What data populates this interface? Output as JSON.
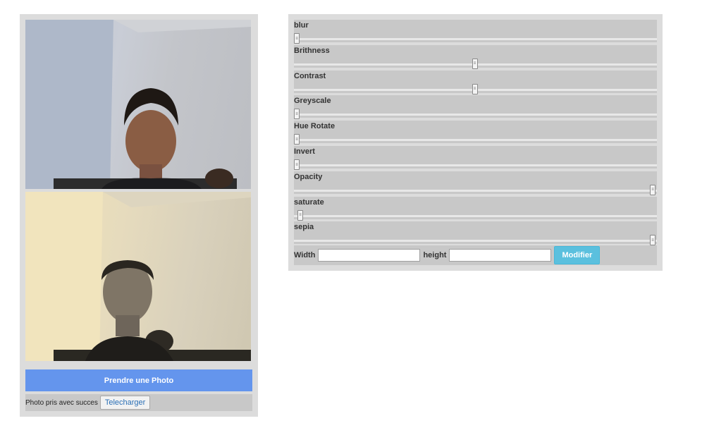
{
  "camera": {
    "take_photo_label": "Prendre une Photo",
    "status_text": "Photo pris avec succes",
    "download_label": "Telecharger"
  },
  "filters": [
    {
      "label": "blur",
      "value": 0.0
    },
    {
      "label": "Brithness",
      "value": 0.5
    },
    {
      "label": "Contrast",
      "value": 0.5
    },
    {
      "label": "Greyscale",
      "value": 0.0
    },
    {
      "label": "Hue Rotate",
      "value": 0.0
    },
    {
      "label": "Invert",
      "value": 0.0
    },
    {
      "label": "Opacity",
      "value": 1.0
    },
    {
      "label": "saturate",
      "value": 0.01
    },
    {
      "label": "sepia",
      "value": 1.0
    }
  ],
  "size": {
    "width_label": "Width",
    "height_label": "height",
    "width_value": "",
    "height_value": "",
    "modify_label": "Modifier"
  },
  "colors": {
    "take_photo_bg": "#6495ed",
    "modify_bg": "#5bc0de",
    "panel_bg": "#dcdcdc",
    "row_bg": "#c8c8c8"
  }
}
